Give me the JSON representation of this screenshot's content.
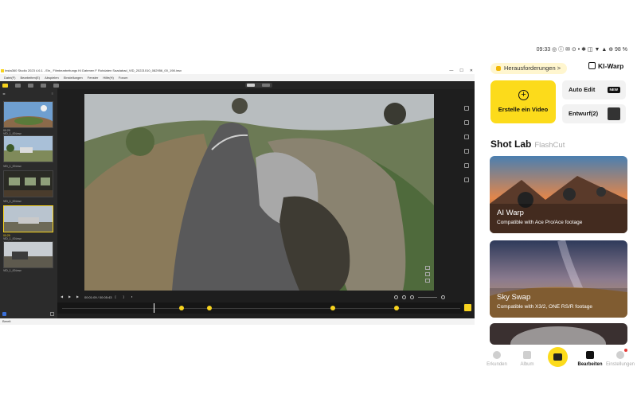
{
  "desktop": {
    "title": "Insta360 Studio 2023 4.6.1 - Ein_ Filmbearbeitungs Kt Datenen F Rohdaten Saadabad_VID_20221010_082956_00_198.insv",
    "window_controls": [
      "—",
      "☐",
      "✕"
    ],
    "menu": [
      "Datei(F)",
      "Bearbeiten(E)",
      "Abspielen",
      "Einstellungen",
      "Fenster",
      "Hilfe(H)",
      "Forum"
    ],
    "thumbnails": [
      {
        "label": "VID_1_00.insv",
        "tag": "00:29",
        "selected": false
      },
      {
        "label": "VID_1_00.insv",
        "tag": "",
        "selected": false
      },
      {
        "label": "VID_1_00.insv",
        "tag": "",
        "selected": false
      },
      {
        "label": "VID_1_00.insv",
        "tag": "00:29",
        "selected": true
      },
      {
        "label": "VID_1_00.insv",
        "tag": "",
        "selected": false
      }
    ],
    "transport": {
      "timecode": "00:01:09 / 00:05:43"
    },
    "status": "Bereit",
    "accent": "#f7d31f",
    "keyframes_pct": [
      0.3,
      0.37,
      0.68,
      0.84
    ],
    "playhead_pct": 0.23
  },
  "phone": {
    "status_bar": "09:33 ◎ ⓘ ✉ ⊙ •   ✱ ◫ ▼ ▲ ⊕ 98 %",
    "challenges_chip": "Herausforderungen >",
    "ki_warp": "KI-Warp",
    "create_label": "Erstelle ein Video",
    "auto_edit": "Auto Edit",
    "new_badge": "NEW",
    "drafts": "Entwurf(2)",
    "section_title": "Shot Lab",
    "section_alt": "FlashCut",
    "cards": [
      {
        "title": "AI Warp",
        "subtitle": "Compatible with Ace Pro/Ace footage"
      },
      {
        "title": "Sky Swap",
        "subtitle": "Compatible with X3/2, ONE RS/R footage"
      }
    ],
    "nav": [
      {
        "label": "Erkunden",
        "icon": "compass-icon",
        "active": false
      },
      {
        "label": "Album",
        "icon": "album-icon",
        "active": false
      },
      {
        "label": "Bearbeiten",
        "icon": "scissors-icon",
        "active": true
      },
      {
        "label": "Einstellungen",
        "icon": "gear-icon",
        "active": false
      }
    ],
    "accent": "#fcdb1b"
  }
}
